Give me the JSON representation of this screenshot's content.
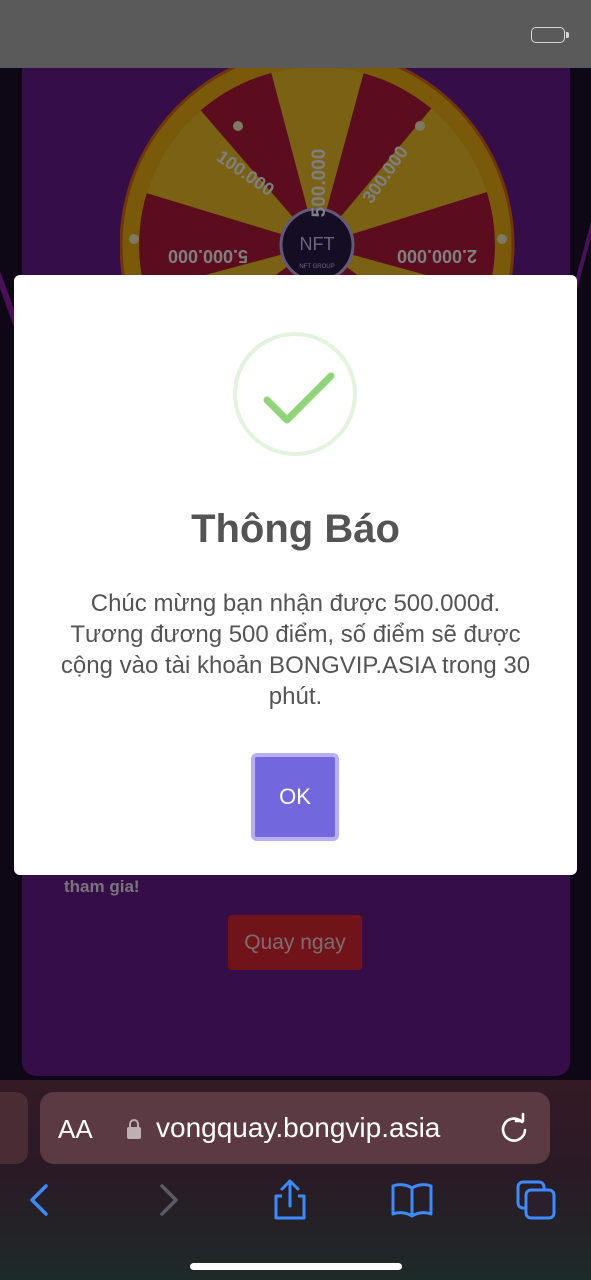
{
  "background_page": {
    "wheel_values": [
      "500.000",
      "300.000",
      "100.000",
      "2.000.000",
      "5.000.000"
    ],
    "wheel_center_label": "NFT GROUP",
    "card_text": "tham gia!",
    "spin_button_label": "Quay ngay"
  },
  "modal": {
    "title": "Thông Báo",
    "message": "Chúc mừng bạn nhận được 500.000đ. Tương đương 500 điểm, số điểm sẽ được cộng vào tài khoản BONGVIP.ASIA trong 30 phút.",
    "ok_label": "OK",
    "icon": "check-icon"
  },
  "browser": {
    "aa_label": "AA",
    "url": "vongquay.bongvip.asia",
    "icons": [
      "lock-icon",
      "reload-icon",
      "back-icon",
      "forward-icon",
      "share-icon",
      "bookmarks-icon",
      "tabs-icon"
    ]
  },
  "colors": {
    "ok_button": "#7367de",
    "check": "#8fd47a",
    "spin_button": "#e02834",
    "card": "#6b1c8f"
  }
}
